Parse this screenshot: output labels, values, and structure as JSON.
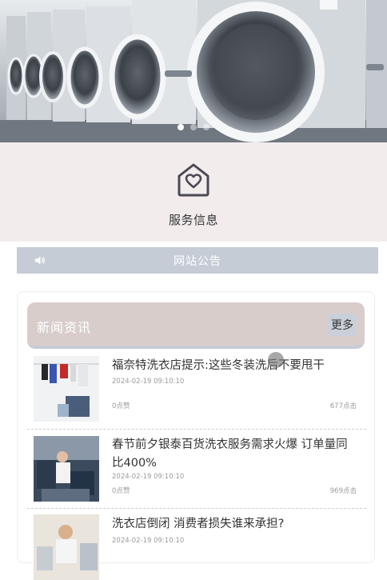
{
  "banner": {
    "dots": 3,
    "active_dot": 1
  },
  "service": {
    "label": "服务信息",
    "icon": "home-heart-icon"
  },
  "notice": {
    "title": "网站公告",
    "icon": "speaker-icon"
  },
  "news": {
    "title": "新闻资讯",
    "more_label": "更多",
    "items": [
      {
        "title": "福奈特洗衣店提示:这些冬装洗后不要甩干",
        "date": "2024-02-19 09:10:10",
        "likes": "0点赞",
        "clicks": "677点击"
      },
      {
        "title": "春节前夕银泰百货洗衣服务需求火爆 订单量同比400%",
        "date": "2024-02-19 09:10:10",
        "likes": "0点赞",
        "clicks": "969点击"
      },
      {
        "title": "洗衣店倒闭 消费者损失谁来承担?",
        "date": "2024-02-19 09:10:10"
      }
    ]
  },
  "colors": {
    "service_bg": "#f2eced",
    "notice_bg": "#c5ccd6",
    "news_head_bg": "#d9cdcc"
  }
}
